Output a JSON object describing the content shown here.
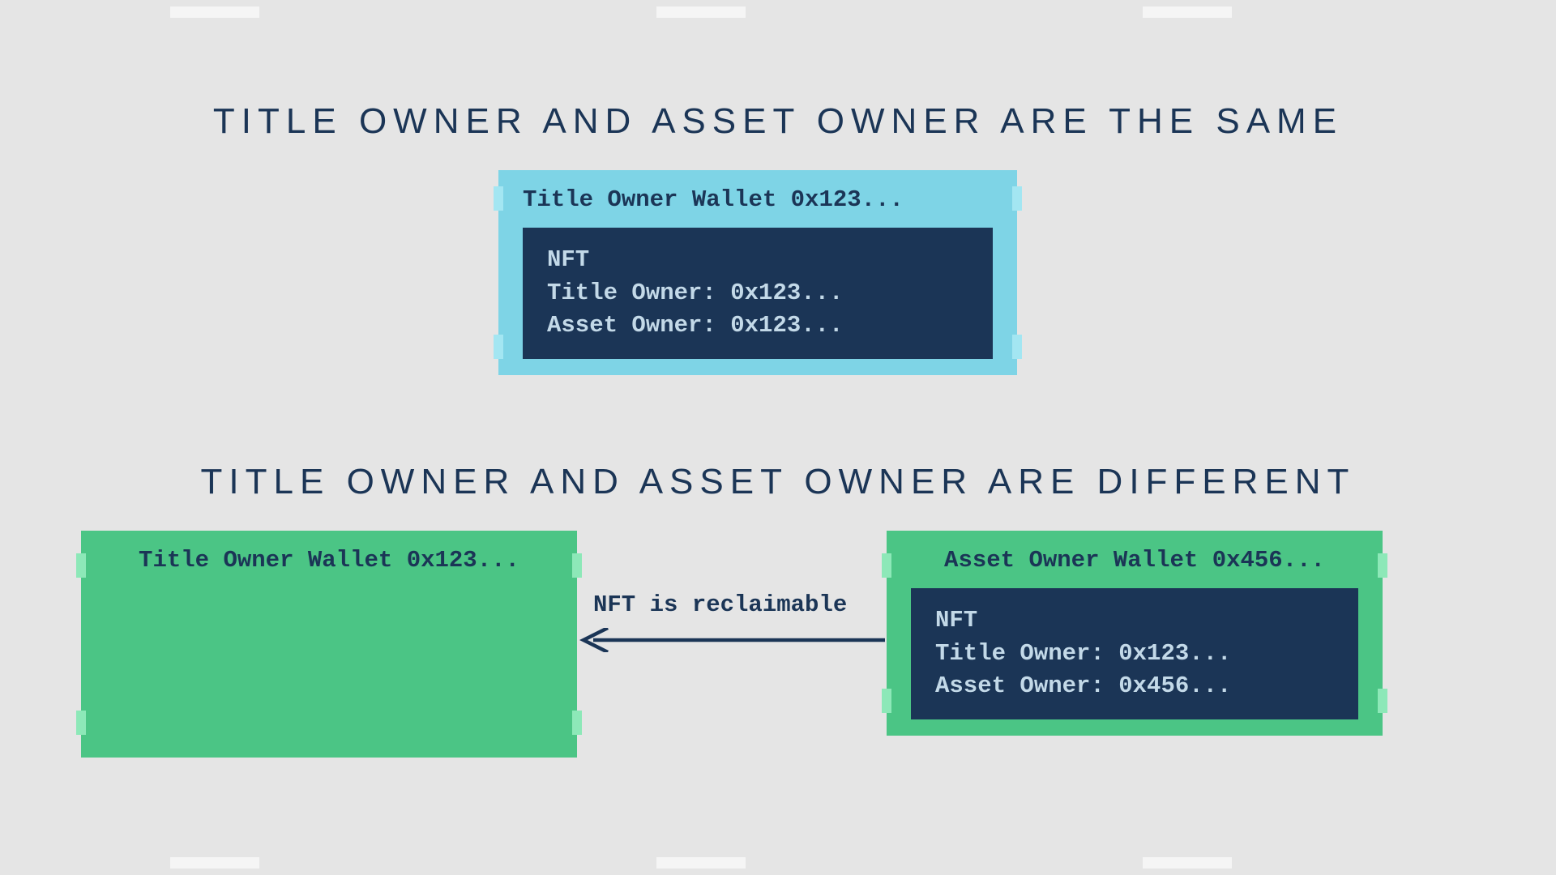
{
  "headings": {
    "same": "TITLE OWNER AND ASSET OWNER ARE THE SAME",
    "diff": "TITLE OWNER AND ASSET OWNER ARE DIFFERENT"
  },
  "sameSection": {
    "walletTitle": "Title Owner Wallet 0x123...",
    "nft": {
      "name": "NFT",
      "titleOwner": "Title Owner: 0x123...",
      "assetOwner": "Asset Owner: 0x123..."
    }
  },
  "diffSection": {
    "leftWalletTitle": "Title Owner Wallet 0x123...",
    "rightWalletTitle": "Asset Owner Wallet 0x456...",
    "arrowLabel": "NFT is reclaimable",
    "nft": {
      "name": "NFT",
      "titleOwner": "Title Owner: 0x123...",
      "assetOwner": "Asset Owner: 0x456..."
    }
  },
  "colors": {
    "navy": "#1b3556",
    "cyan": "#7ed4e6",
    "cyanTick": "#a3e6f2",
    "green": "#4bc585",
    "greenTick": "#8de8b8",
    "bg": "#e5e5e5",
    "frameTick": "#f5f5f5"
  }
}
